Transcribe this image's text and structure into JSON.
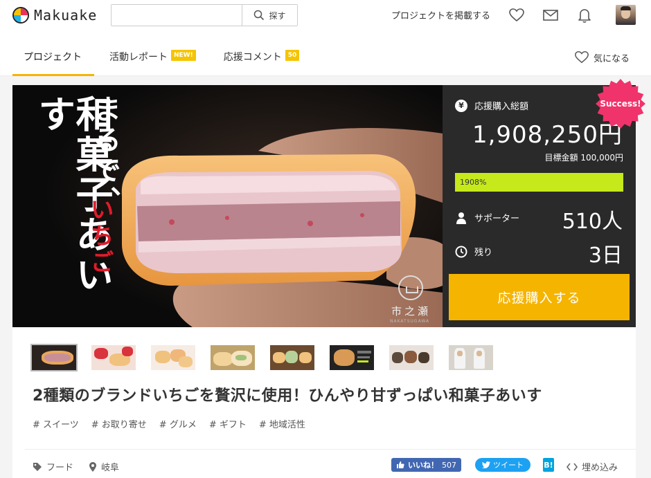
{
  "header": {
    "logo_text": "Makuake",
    "search_placeholder": "",
    "search_button": "探す",
    "post_project": "プロジェクトを掲載する",
    "icons": [
      "heart-icon",
      "mail-icon",
      "bell-icon"
    ]
  },
  "tabs": [
    {
      "label": "プロジェクト",
      "active": true
    },
    {
      "label": "活動レポート",
      "badge": "NEW!"
    },
    {
      "label": "応援コメント",
      "badge": "50"
    }
  ],
  "watch_label": "気になる",
  "hero": {
    "title": "和菓子あいす",
    "subtitle": "まるで、",
    "accent": "いちご",
    "brand": "市之瀬",
    "brand_sub": "NAKATSUGAWA"
  },
  "panel": {
    "amount_label": "応援購入総額",
    "amount": "1,908,250円",
    "goal": "目標金額 100,000円",
    "progress_text": "1908%",
    "progress_fraction": 1.0,
    "supporters_label": "サポーター",
    "supporters": "510人",
    "remaining_label": "残り",
    "remaining": "3日",
    "cta": "応援購入する",
    "success_badge": "Success!"
  },
  "title": "2種類のブランドいちごを贅沢に使用！ひんやり甘ずっぱい和菓子あいす",
  "tags": [
    "# スイーツ",
    "# お取り寄せ",
    "# グルメ",
    "# ギフト",
    "# 地域活性"
  ],
  "meta": {
    "category": "フード",
    "location": "岐阜"
  },
  "social": {
    "like_label": "いいね！",
    "like_count": "507",
    "tweet": "ツイート",
    "hatena": "B!",
    "embed": "埋め込み"
  },
  "colors": {
    "accent": "#f5b400",
    "panel_bg": "#2a2a2a",
    "progress": "#c5e91b",
    "success_badge": "#f0336b",
    "strawberry_red": "#e01b2a"
  }
}
